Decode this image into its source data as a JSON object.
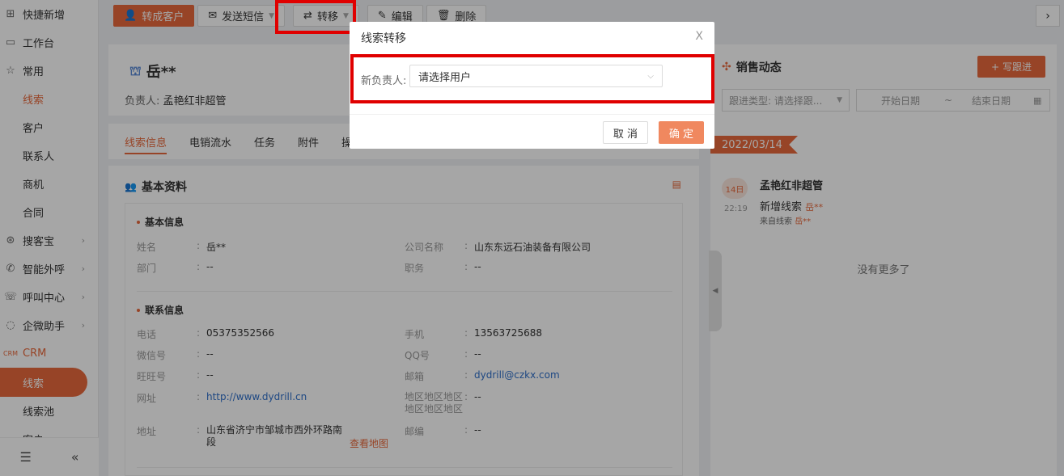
{
  "sidebar": {
    "items": [
      {
        "icon": "plus-square-icon",
        "label": "快捷新增"
      },
      {
        "icon": "monitor-icon",
        "label": "工作台"
      },
      {
        "icon": "star-icon",
        "label": "常用"
      },
      {
        "label": "线索"
      },
      {
        "label": "客户"
      },
      {
        "label": "联系人"
      },
      {
        "label": "商机"
      },
      {
        "label": "合同"
      },
      {
        "icon": "search-circle-icon",
        "label": "搜客宝"
      },
      {
        "icon": "phone-icon",
        "label": "智能外呼"
      },
      {
        "icon": "headset-icon",
        "label": "呼叫中心"
      },
      {
        "icon": "chat-icon",
        "label": "企微助手"
      },
      {
        "icon": "crm-icon",
        "label": "CRM"
      },
      {
        "label": "线索"
      },
      {
        "label": "线索池"
      },
      {
        "label": "客户"
      }
    ]
  },
  "toolbar": {
    "convert_label": "转成客户",
    "sms_label": "发送短信",
    "transfer_label": "转移",
    "edit_label": "编辑",
    "delete_label": "删除"
  },
  "lead": {
    "name": "岳**",
    "owner_label": "负责人:",
    "owner": "孟艳红非超管"
  },
  "tabs": [
    "线索信息",
    "电销流水",
    "任务",
    "附件",
    "操作"
  ],
  "info": {
    "section_title": "基本资料",
    "basic_title": "基本信息",
    "contact_title": "联系信息",
    "fields": {
      "name_label": "姓名",
      "name_value": "岳**",
      "company_label": "公司名称",
      "company_value": "山东东远石油装备有限公司",
      "dept_label": "部门",
      "dept_value": "--",
      "position_label": "职务",
      "position_value": "--",
      "phone_label": "电话",
      "phone_value": "05375352566",
      "mobile_label": "手机",
      "mobile_value": "13563725688",
      "wechat_label": "微信号",
      "wechat_value": "--",
      "qq_label": "QQ号",
      "qq_value": "--",
      "wangwang_label": "旺旺号",
      "wangwang_value": "--",
      "email_label": "邮箱",
      "email_value": "dydrill@czkx.com",
      "website_label": "网址",
      "website_value": "http://www.dydrill.cn",
      "region_label": "地区地区地区地区地区地区",
      "region_value": "--",
      "address_label": "地址",
      "address_value": "山东省济宁市邹城市西外环路南段",
      "map_link": "查看地图",
      "zip_label": "邮编",
      "zip_value": "--"
    }
  },
  "sales": {
    "title": "销售动态",
    "write_button": "写跟进",
    "type_placeholder": "跟进类型: 请选择跟...",
    "start_date": "开始日期",
    "range_sep": "~",
    "end_date": "结束日期",
    "date_tag": "2022/03/14",
    "day": "14日",
    "time": "22:19",
    "user": "孟艳红非超管",
    "action_text": "新增线索",
    "action_target": "岳**",
    "source_text": "来自线索",
    "source_target": "岳**",
    "no_more": "没有更多了"
  },
  "modal": {
    "title": "线索转移",
    "close": "X",
    "new_owner_label": "新负责人:",
    "select_placeholder": "请选择用户",
    "cancel": "取 消",
    "ok": "确 定"
  },
  "colors": {
    "accent": "#e8693c",
    "highlight_box": "#e00000",
    "link": "#2f6fc9"
  }
}
